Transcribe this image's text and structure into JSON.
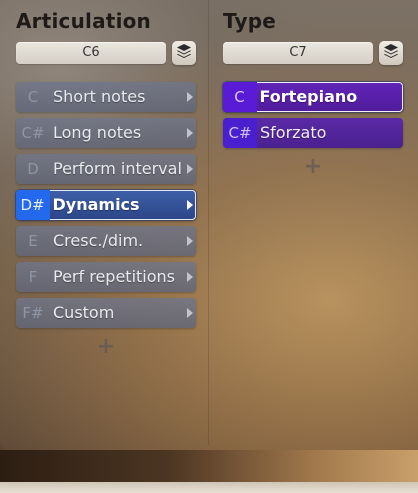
{
  "articulation": {
    "title": "Articulation",
    "note": "C6",
    "items": [
      {
        "key": "C",
        "label": "Short notes"
      },
      {
        "key": "C#",
        "label": "Long notes"
      },
      {
        "key": "D",
        "label": "Perform interval"
      },
      {
        "key": "D#",
        "label": "Dynamics",
        "selected": true
      },
      {
        "key": "E",
        "label": "Cresc./dim."
      },
      {
        "key": "F",
        "label": "Perf repetitions"
      },
      {
        "key": "F#",
        "label": "Custom"
      }
    ],
    "add_label": "+"
  },
  "type": {
    "title": "Type",
    "note": "C7",
    "items": [
      {
        "key": "C",
        "label": "Fortepiano",
        "selected": true
      },
      {
        "key": "C#",
        "label": "Sforzato"
      }
    ],
    "add_label": "+"
  },
  "icons": {
    "layers": "layers-icon",
    "submenu": "chevron-right-icon",
    "add": "plus-icon"
  },
  "colors": {
    "articulation_item": "#6a7088",
    "articulation_selected": "#2c4688",
    "articulation_selected_key": "#2369ee",
    "type_item": "#4b2190",
    "type_key": "#4a1fd0",
    "selected_border": "#e4e8f4"
  }
}
